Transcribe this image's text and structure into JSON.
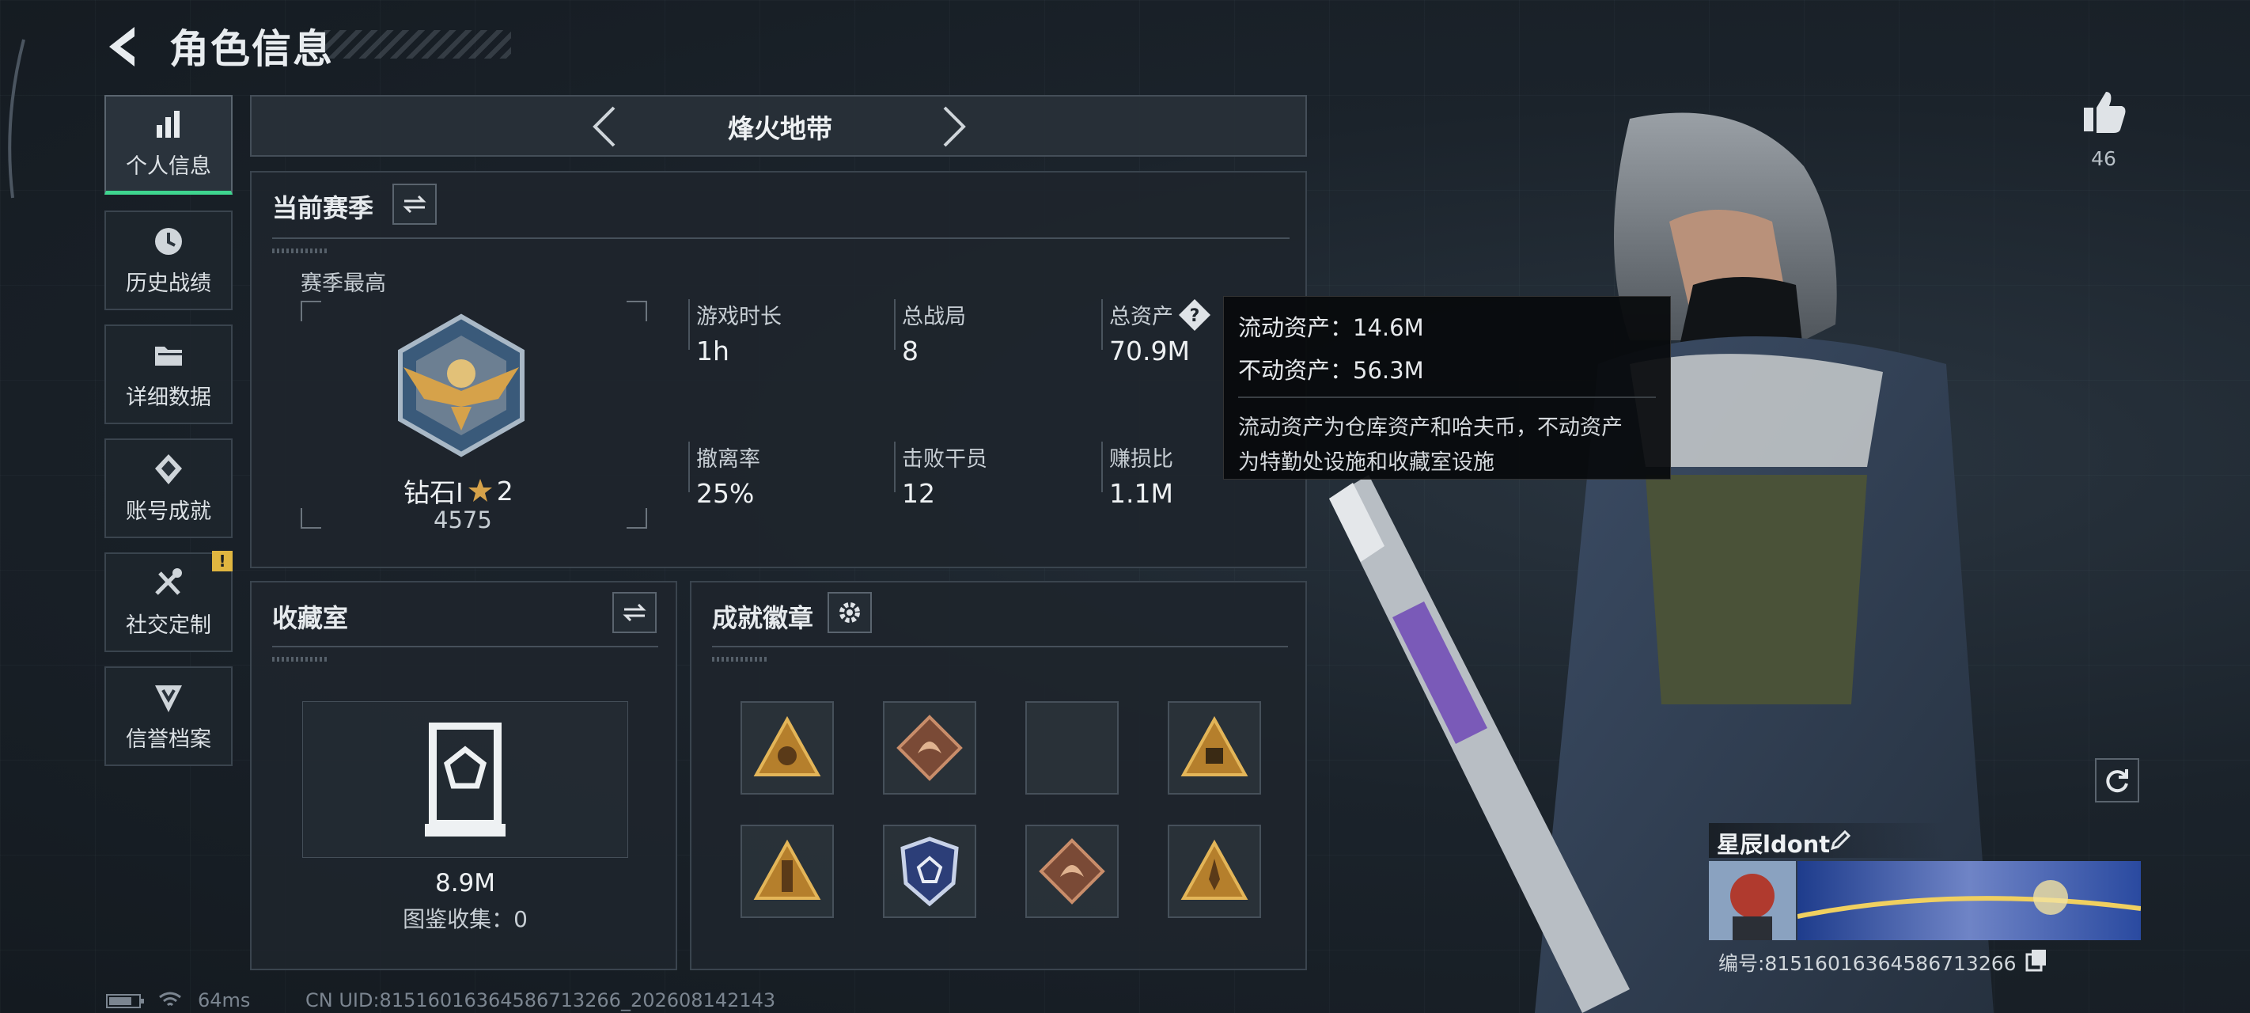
{
  "header": {
    "title": "角色信息"
  },
  "nav": {
    "items": [
      {
        "label": "个人信息",
        "icon": "bar-chart-icon",
        "active": true
      },
      {
        "label": "历史战绩",
        "icon": "history-icon",
        "active": false
      },
      {
        "label": "详细数据",
        "icon": "folder-icon",
        "active": false
      },
      {
        "label": "账号成就",
        "icon": "achievement-icon",
        "active": false
      },
      {
        "label": "社交定制",
        "icon": "tools-icon",
        "active": false,
        "alert": "!"
      },
      {
        "label": "信誉档案",
        "icon": "credit-icon",
        "active": false
      }
    ]
  },
  "mode": {
    "title": "烽火地带"
  },
  "season": {
    "title": "当前赛季",
    "best_label": "赛季最高",
    "rank_name": "钻石I",
    "rank_stars": "2",
    "rank_score": "4575",
    "stats": [
      {
        "label": "游戏时长",
        "value": "1h"
      },
      {
        "label": "总战局",
        "value": "8"
      },
      {
        "label": "总资产",
        "value": "70.9M"
      },
      {
        "label": "撤离率",
        "value": "25%"
      },
      {
        "label": "击败干员",
        "value": "12"
      },
      {
        "label": "赚损比",
        "value": "1.1M"
      }
    ]
  },
  "tooltip": {
    "liquid": "流动资产：14.6M",
    "fixed": "不动资产：56.3M",
    "desc_line1": "流动资产为仓库资产和哈夫币，不动资产",
    "desc_line2": "为特勤处设施和收藏室设施"
  },
  "collection": {
    "title": "收藏室",
    "value": "8.9M",
    "catalog": "图鉴收集：0"
  },
  "badges": {
    "title": "成就徽章",
    "slots": [
      "triangle-emblem-icon",
      "dragon-emblem-icon",
      "empty-slot",
      "triangle-58-emblem-icon",
      "triangle-tower-emblem-icon",
      "shield-emblem-icon",
      "dragon-emblem-icon",
      "triangle-rocket-emblem-icon"
    ]
  },
  "profile": {
    "likes": "46",
    "name": "星辰ldont",
    "id": "编号:8151601636458671326​6"
  },
  "status": {
    "ping": "64ms",
    "uid": "CN UID:8151601636458671326​6_202608142143"
  },
  "colors": {
    "accent": "#3fd58f",
    "alert": "#e0b640",
    "gold": "#d6a24a"
  }
}
